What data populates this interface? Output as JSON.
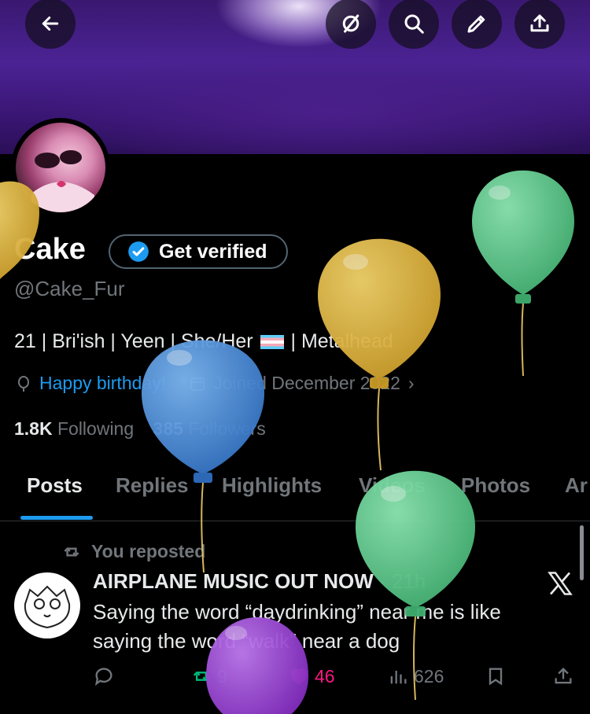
{
  "header": {
    "back_icon": "arrow-left-icon",
    "grok_icon": "grok-icon",
    "search_icon": "search-icon",
    "edit_icon": "pencil-icon",
    "share_icon": "share-icon"
  },
  "profile": {
    "name": "Cake",
    "get_verified_label": "Get verified",
    "handle": "@Cake_Fur",
    "bio_part1": "21 | Bri'ish | Yeen | She/Her",
    "bio_part2": "| Metalhead",
    "birthday": "Happy birthday!",
    "joined": "Joined December 2022",
    "following_count": "1.8K",
    "following_label": "Following",
    "followers_count": "385",
    "followers_label": "Followers"
  },
  "tabs": [
    "Posts",
    "Replies",
    "Highlights",
    "Videos",
    "Photos",
    "Ar"
  ],
  "post": {
    "repost_label": "You reposted",
    "author": "AIRPLANE MUSIC OUT NOW",
    "time": "· 21h",
    "text": "Saying the word “daydrinking” near me is like saying the word “walk” near a dog",
    "replies": "",
    "reposts": "9",
    "likes": "46",
    "views": "626"
  },
  "colors": {
    "accent": "#1d9bf0",
    "like": "#f91880",
    "repost": "#00ba7c",
    "balloon_yellow": "#e2b93b",
    "balloon_green": "#5fcf8f",
    "balloon_blue": "#4a8fdc",
    "balloon_purple": "#9a3fd6"
  }
}
